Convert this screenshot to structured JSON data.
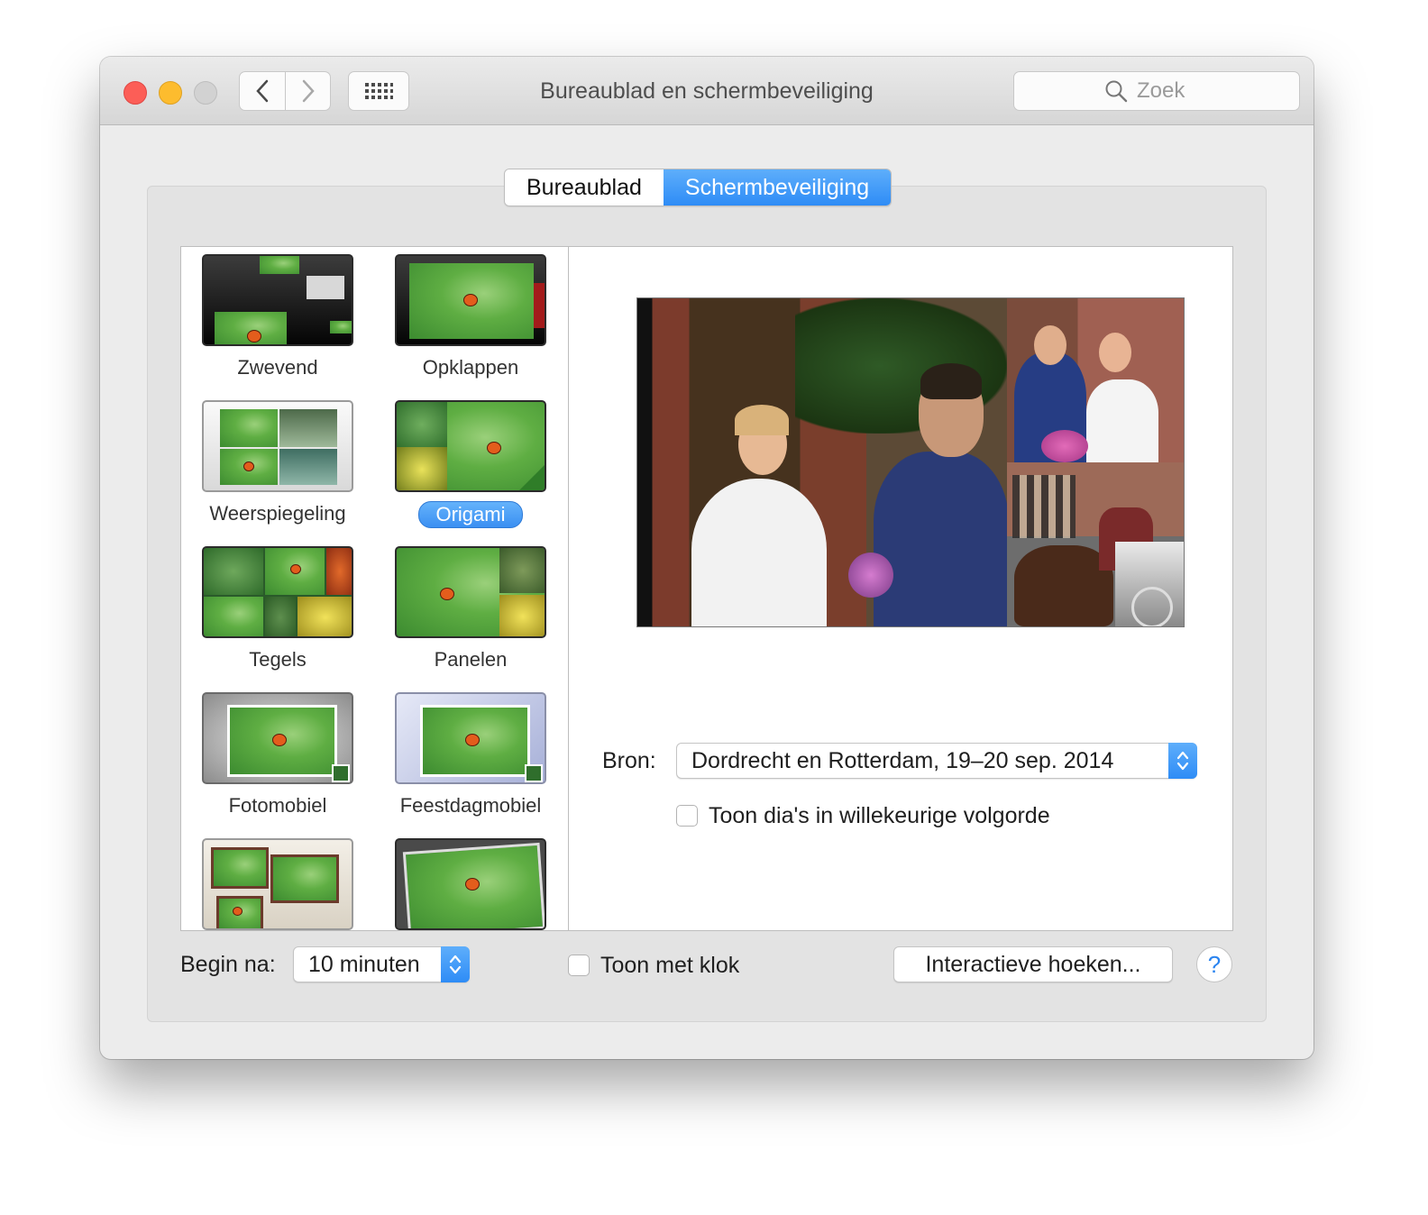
{
  "window": {
    "title": "Bureaublad en schermbeveiliging"
  },
  "search": {
    "placeholder": "Zoek"
  },
  "tabs": [
    {
      "label": "Bureaublad",
      "active": false
    },
    {
      "label": "Schermbeveiliging",
      "active": true
    }
  ],
  "screensavers": [
    {
      "label": "Zwevend",
      "selected": false
    },
    {
      "label": "Opklappen",
      "selected": false
    },
    {
      "label": "Weerspiegeling",
      "selected": false
    },
    {
      "label": "Origami",
      "selected": true
    },
    {
      "label": "Tegels",
      "selected": false
    },
    {
      "label": "Panelen",
      "selected": false
    },
    {
      "label": "Fotomobiel",
      "selected": false
    },
    {
      "label": "Feestdagmobiel",
      "selected": false
    }
  ],
  "options": {
    "source_label": "Bron:",
    "source_value": "Dordrecht en Rotterdam, 19–20 sep. 2014",
    "shuffle_label": "Toon dia's in willekeurige volgorde",
    "shuffle_checked": false
  },
  "footer": {
    "start_after_label": "Begin na:",
    "start_after_value": "10 minuten",
    "show_clock_label": "Toon met klok",
    "show_clock_checked": false,
    "hot_corners_label": "Interactieve hoeken...",
    "help_label": "?"
  },
  "colors": {
    "accent": "#2e8cf6",
    "close": "#fc5e57",
    "minimize": "#fdbc2e",
    "zoom": "#d2d2d2"
  }
}
